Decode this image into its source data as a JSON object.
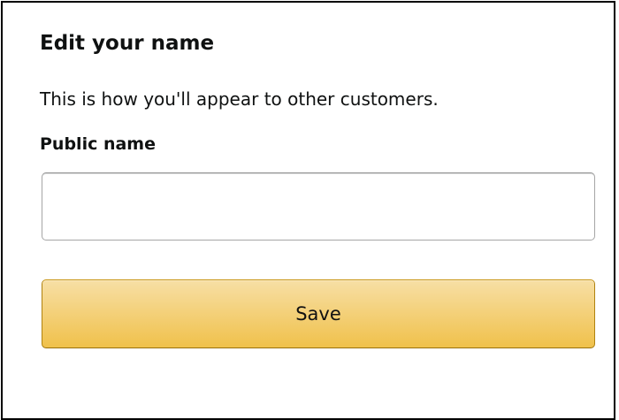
{
  "dialog": {
    "title": "Edit your name",
    "subtitle": "This is how you'll appear to other customers.",
    "field_label": "Public name",
    "name_input": {
      "value": "",
      "placeholder": ""
    },
    "save_label": "Save"
  },
  "colors": {
    "button_top": "#f7dfa5",
    "button_bottom": "#f0c14b",
    "button_border": "#a88734",
    "input_border": "#a6a6a6",
    "text": "#0f1111"
  }
}
